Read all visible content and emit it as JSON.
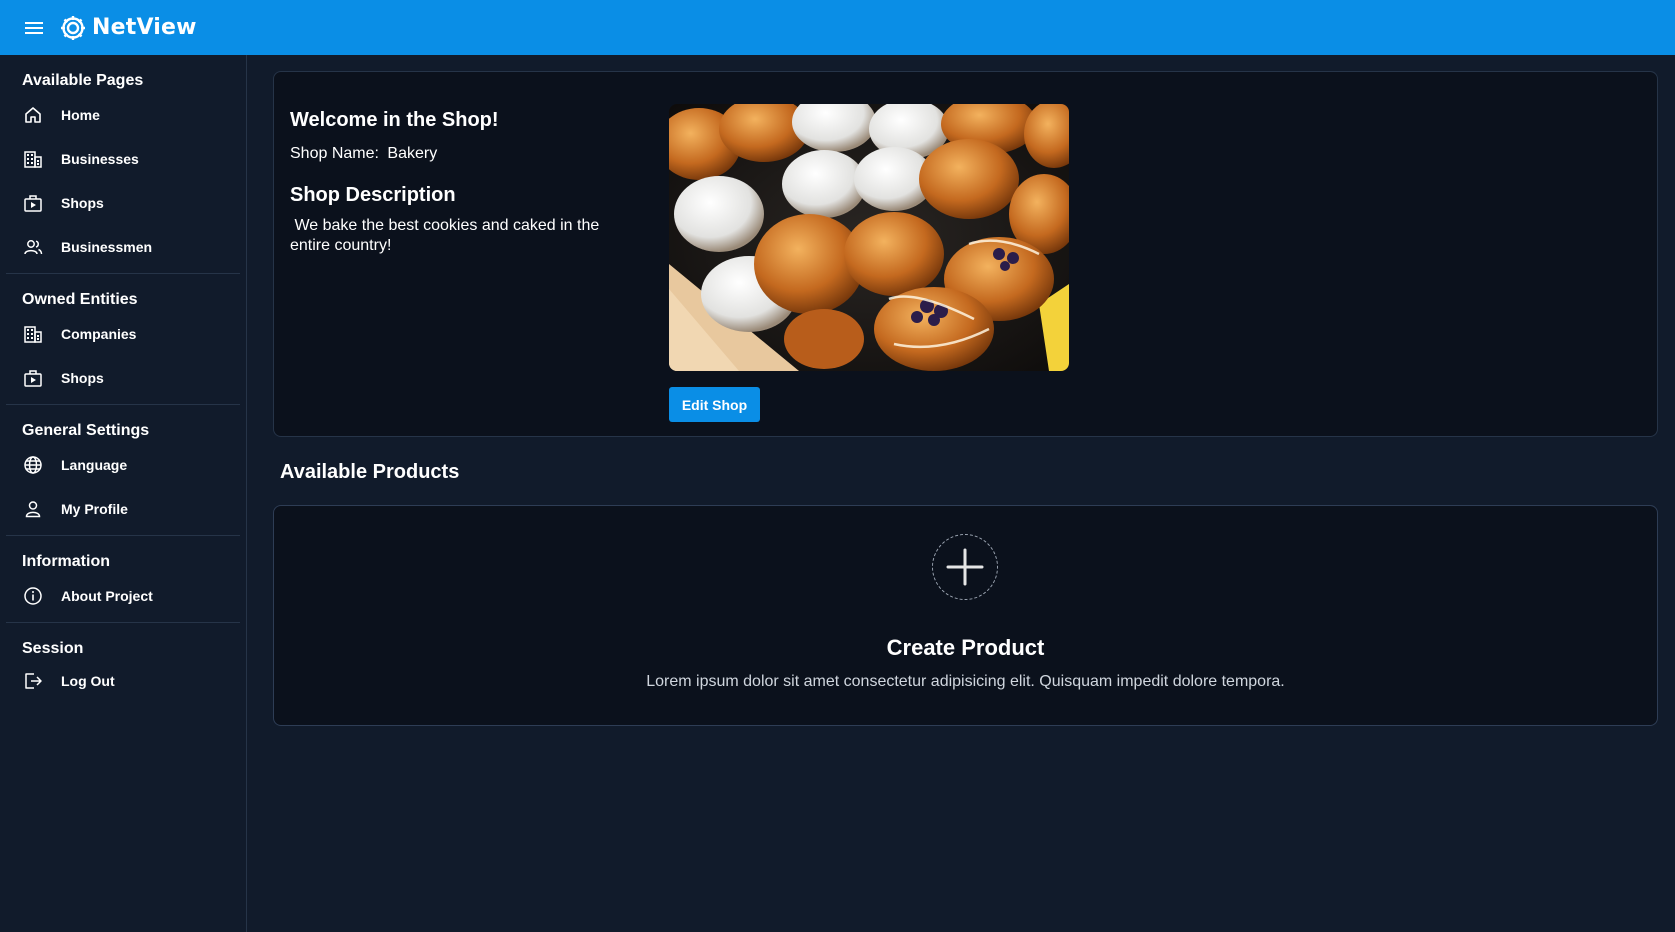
{
  "app": {
    "brand_name": "NetView"
  },
  "sidebar": {
    "sections": [
      {
        "title": "Available Pages",
        "items": [
          {
            "label": "Home",
            "icon": "home-icon"
          },
          {
            "label": "Businesses",
            "icon": "building-icon"
          },
          {
            "label": "Shops",
            "icon": "storefront-icon"
          },
          {
            "label": "Businessmen",
            "icon": "people-icon"
          }
        ]
      },
      {
        "title": "Owned Entities",
        "items": [
          {
            "label": "Companies",
            "icon": "building-icon"
          },
          {
            "label": "Shops",
            "icon": "storefront-icon"
          }
        ]
      },
      {
        "title": "General Settings",
        "items": [
          {
            "label": "Language",
            "icon": "globe-icon"
          },
          {
            "label": "My Profile",
            "icon": "person-icon"
          }
        ]
      },
      {
        "title": "Information",
        "items": [
          {
            "label": "About Project",
            "icon": "info-icon"
          }
        ]
      },
      {
        "title": "Session",
        "items": [
          {
            "label": "Log Out",
            "icon": "logout-icon"
          }
        ]
      }
    ]
  },
  "shop": {
    "welcome": "Welcome in the Shop!",
    "name_label": "Shop Name:",
    "name_value": "Bakery",
    "description_title": "Shop Description",
    "description": " We bake the best cookies and caked in the entire country!",
    "edit_label": "Edit Shop",
    "image": "bakery-pastries-photo"
  },
  "products": {
    "title": "Available Products",
    "create_title": "Create Product",
    "create_description": "Lorem ipsum dolor sit amet consectetur adipisicing elit. Quisquam impedit dolore tempora."
  },
  "colors": {
    "accent": "#0a8ee6",
    "background": "#111b2b",
    "card": "#0b111c",
    "border": "#263448"
  }
}
